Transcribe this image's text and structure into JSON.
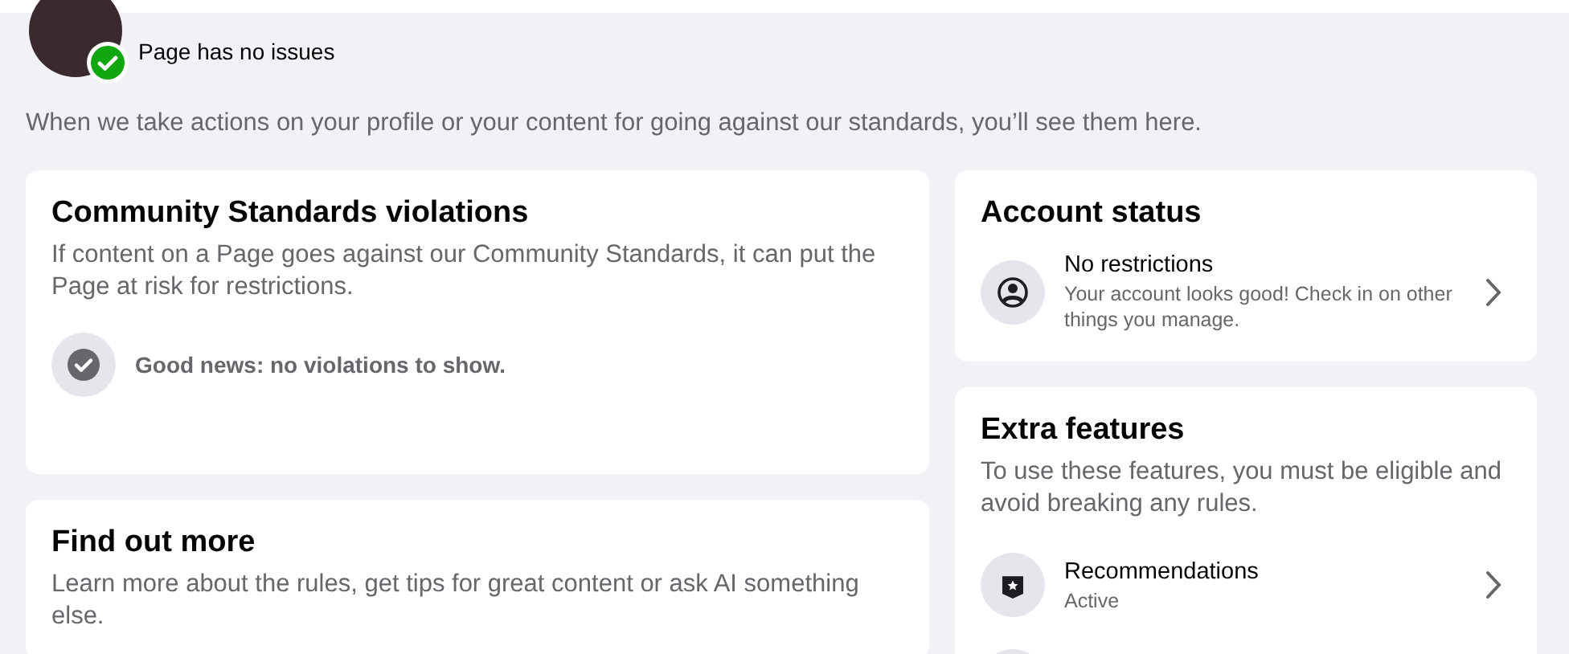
{
  "page": {
    "status": "Page has no issues",
    "status_ok": true
  },
  "intro": "When we take actions on your profile or your content for going against our standards, you’ll see them here.",
  "violations": {
    "title": "Community Standards violations",
    "description": "If content on a Page goes against our Community Standards, it can put the Page at risk for restrictions.",
    "message": "Good news: no violations to show."
  },
  "find_out_more": {
    "title": "Find out more",
    "description": "Learn more about the rules, get tips for great content or ask AI something else."
  },
  "account_status": {
    "title": "Account status",
    "items": [
      {
        "kind": "person",
        "title": "No restrictions",
        "subtitle": "Your account looks good! Check in on other things you manage."
      }
    ]
  },
  "extra_features": {
    "title": "Extra features",
    "description": "To use these features, you must be eligible and avoid breaking any rules.",
    "items": [
      {
        "kind": "badge",
        "title": "Recommendations",
        "subtitle": "Active"
      }
    ]
  }
}
